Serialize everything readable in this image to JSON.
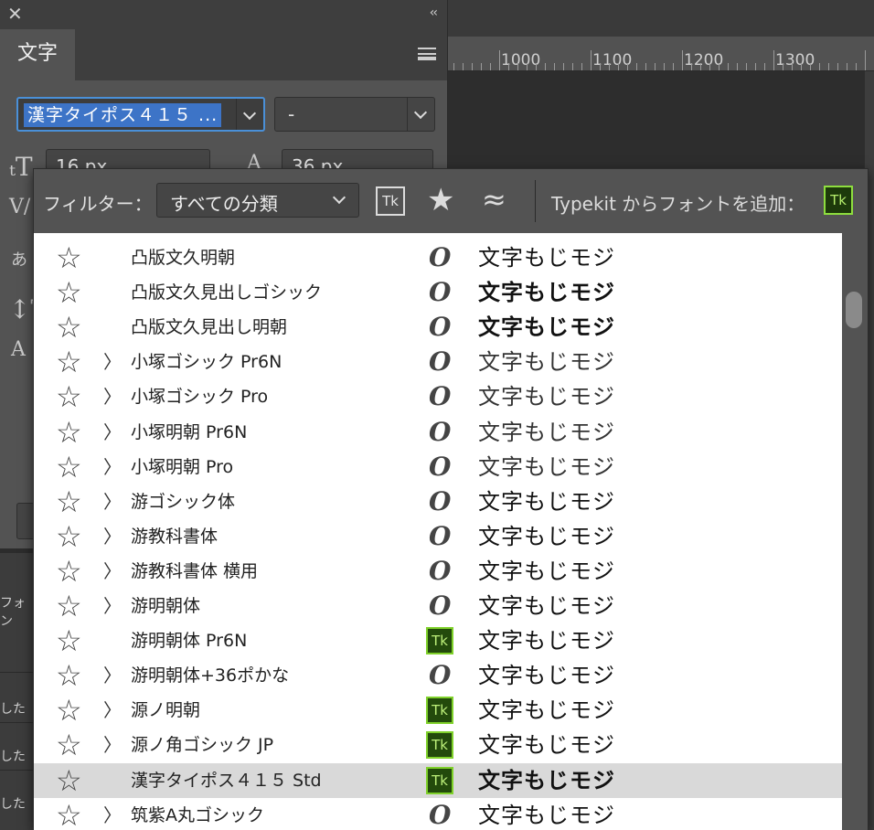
{
  "panel": {
    "tab_label": "文字",
    "font_family_value": "漢字タイポス４１５ ...",
    "font_style_value": "-",
    "size_value": "16 px",
    "leading_value": "36 px"
  },
  "ruler": {
    "labels": [
      "1000",
      "1100",
      "1200",
      "1300"
    ]
  },
  "lower_left": {
    "label_font": "フォン",
    "label_1": "した",
    "label_2": "した",
    "label_3": "した"
  },
  "filter_bar": {
    "filter_label": "フィルター：",
    "classification_value": "すべての分類",
    "typekit_filter_label": "Tk",
    "add_typekit_label": "Typekit からフォントを追加：",
    "add_typekit_icon_label": "Tk"
  },
  "fonts": [
    {
      "name": "凸版文久明朝",
      "expandable": false,
      "type": "opentype",
      "sample": "文字もじモジ",
      "weight": "normal"
    },
    {
      "name": "凸版文久見出しゴシック",
      "expandable": false,
      "type": "opentype",
      "sample": "文字もじモジ",
      "weight": "bold"
    },
    {
      "name": "凸版文久見出し明朝",
      "expandable": false,
      "type": "opentype",
      "sample": "文字もじモジ",
      "weight": "bold"
    },
    {
      "name": "小塚ゴシック Pr6N",
      "expandable": true,
      "type": "opentype",
      "sample": "文字もじモジ",
      "weight": "light"
    },
    {
      "name": "小塚ゴシック Pro",
      "expandable": true,
      "type": "opentype",
      "sample": "文字もじモジ",
      "weight": "light"
    },
    {
      "name": "小塚明朝 Pr6N",
      "expandable": true,
      "type": "opentype",
      "sample": "文字もじモジ",
      "weight": "light"
    },
    {
      "name": "小塚明朝 Pro",
      "expandable": true,
      "type": "opentype",
      "sample": "文字もじモジ",
      "weight": "light"
    },
    {
      "name": "游ゴシック体",
      "expandable": true,
      "type": "opentype",
      "sample": "文字もじモジ",
      "weight": "normal"
    },
    {
      "name": "游教科書体",
      "expandable": true,
      "type": "opentype",
      "sample": "文字もじモジ",
      "weight": "normal"
    },
    {
      "name": "游教科書体 横用",
      "expandable": true,
      "type": "opentype",
      "sample": "文字もじモジ",
      "weight": "normal"
    },
    {
      "name": "游明朝体",
      "expandable": true,
      "type": "opentype",
      "sample": "文字もじモジ",
      "weight": "normal"
    },
    {
      "name": "游明朝体 Pr6N",
      "expandable": false,
      "type": "typekit",
      "sample": "文字もじモジ",
      "weight": "normal"
    },
    {
      "name": "游明朝体+36ポかな",
      "expandable": true,
      "type": "opentype",
      "sample": "文字もじモジ",
      "weight": "normal"
    },
    {
      "name": "源ノ明朝",
      "expandable": true,
      "type": "typekit",
      "sample": "文字もじモジ",
      "weight": "normal"
    },
    {
      "name": "源ノ角ゴシック JP",
      "expandable": true,
      "type": "typekit",
      "sample": "文字もじモジ",
      "weight": "normal"
    },
    {
      "name": "漢字タイポス４１５ Std",
      "expandable": false,
      "type": "typekit",
      "sample": "文字もじモジ",
      "weight": "bold",
      "selected": true
    },
    {
      "name": "筑紫A丸ゴシック",
      "expandable": true,
      "type": "opentype",
      "sample": "文字もじモジ",
      "weight": "normal"
    }
  ],
  "icons": {
    "star": "☆",
    "expand": "〉",
    "opentype": "O",
    "typekit": "Tk",
    "favorite": "★",
    "similar": "≈",
    "close": "✕",
    "collapse": "‹‹"
  },
  "colors": {
    "panel_bg": "#535353",
    "selection_blue": "#3d74c7",
    "typekit_green": "#7fd12a",
    "list_bg": "#ffffff",
    "selected_row": "#d9d9d9"
  }
}
